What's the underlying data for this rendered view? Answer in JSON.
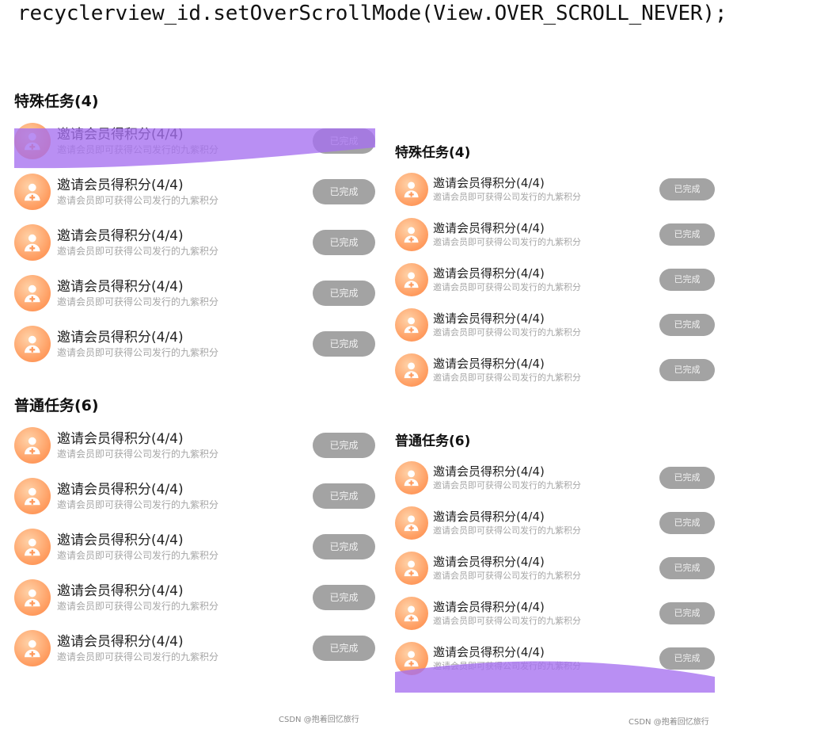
{
  "code_line": "recyclerview_id.setOverScrollMode(View.OVER_SCROLL_NEVER);",
  "colors": {
    "overscroll_glow": "#a56ff0",
    "avatar_gradient": [
      "#ffd2a8",
      "#ff8a4a"
    ],
    "done_button": "#a3a3a3",
    "description_text": "#a6a6a6"
  },
  "left_panel": {
    "special": {
      "title": "特殊任务(4)",
      "items": [
        {
          "title": "邀请会员得积分(4/4)",
          "desc": "邀请会员即可获得公司发行的九紫积分",
          "button": "已完成",
          "icon": "person-add-icon"
        },
        {
          "title": "邀请会员得积分(4/4)",
          "desc": "邀请会员即可获得公司发行的九紫积分",
          "button": "已完成",
          "icon": "person-add-icon"
        },
        {
          "title": "邀请会员得积分(4/4)",
          "desc": "邀请会员即可获得公司发行的九紫积分",
          "button": "已完成",
          "icon": "person-add-icon"
        },
        {
          "title": "邀请会员得积分(4/4)",
          "desc": "邀请会员即可获得公司发行的九紫积分",
          "button": "已完成",
          "icon": "person-add-icon"
        },
        {
          "title": "邀请会员得积分(4/4)",
          "desc": "邀请会员即可获得公司发行的九紫积分",
          "button": "已完成",
          "icon": "person-add-icon"
        }
      ]
    },
    "normal": {
      "title": "普通任务(6)",
      "items": [
        {
          "title": "邀请会员得积分(4/4)",
          "desc": "邀请会员即可获得公司发行的九紫积分",
          "button": "已完成",
          "icon": "person-add-icon"
        },
        {
          "title": "邀请会员得积分(4/4)",
          "desc": "邀请会员即可获得公司发行的九紫积分",
          "button": "已完成",
          "icon": "person-add-icon"
        },
        {
          "title": "邀请会员得积分(4/4)",
          "desc": "邀请会员即可获得公司发行的九紫积分",
          "button": "已完成",
          "icon": "person-add-icon"
        },
        {
          "title": "邀请会员得积分(4/4)",
          "desc": "邀请会员即可获得公司发行的九紫积分",
          "button": "已完成",
          "icon": "person-add-icon"
        },
        {
          "title": "邀请会员得积分(4/4)",
          "desc": "邀请会员即可获得公司发行的九紫积分",
          "button": "已完成",
          "icon": "person-add-icon"
        }
      ]
    },
    "watermark": "CSDN @抱着回忆旅行"
  },
  "right_panel": {
    "special": {
      "title": "特殊任务(4)",
      "items": [
        {
          "title": "邀请会员得积分(4/4)",
          "desc": "邀请会员即可获得公司发行的九紫积分",
          "button": "已完成",
          "icon": "person-add-icon"
        },
        {
          "title": "邀请会员得积分(4/4)",
          "desc": "邀请会员即可获得公司发行的九紫积分",
          "button": "已完成",
          "icon": "person-add-icon"
        },
        {
          "title": "邀请会员得积分(4/4)",
          "desc": "邀请会员即可获得公司发行的九紫积分",
          "button": "已完成",
          "icon": "person-add-icon"
        },
        {
          "title": "邀请会员得积分(4/4)",
          "desc": "邀请会员即可获得公司发行的九紫积分",
          "button": "已完成",
          "icon": "person-add-icon"
        },
        {
          "title": "邀请会员得积分(4/4)",
          "desc": "邀请会员即可获得公司发行的九紫积分",
          "button": "已完成",
          "icon": "person-add-icon"
        }
      ]
    },
    "normal": {
      "title": "普通任务(6)",
      "items": [
        {
          "title": "邀请会员得积分(4/4)",
          "desc": "邀请会员即可获得公司发行的九紫积分",
          "button": "已完成",
          "icon": "person-add-icon"
        },
        {
          "title": "邀请会员得积分(4/4)",
          "desc": "邀请会员即可获得公司发行的九紫积分",
          "button": "已完成",
          "icon": "person-add-icon"
        },
        {
          "title": "邀请会员得积分(4/4)",
          "desc": "邀请会员即可获得公司发行的九紫积分",
          "button": "已完成",
          "icon": "person-add-icon"
        },
        {
          "title": "邀请会员得积分(4/4)",
          "desc": "邀请会员即可获得公司发行的九紫积分",
          "button": "已完成",
          "icon": "person-add-icon"
        },
        {
          "title": "邀请会员得积分(4/4)",
          "desc": "邀请会员即可获得公司发行的九紫积分",
          "button": "已完成",
          "icon": "person-add-icon"
        }
      ]
    },
    "watermark": "CSDN @抱着回忆旅行"
  }
}
